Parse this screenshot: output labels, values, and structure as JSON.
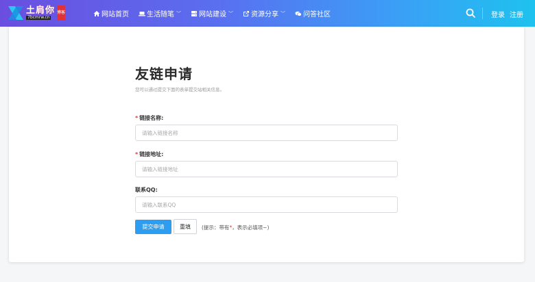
{
  "brand": {
    "logo_text": "土肩你",
    "logo_sub": "7bcmrw.cn",
    "logo_badge": "博客",
    "colors": {
      "header_start": "#6a4ee0",
      "header_end": "#1ec2ee",
      "accent": "#2e9df0",
      "required": "#e33333"
    }
  },
  "nav": {
    "items": [
      {
        "label": "网站首页",
        "icon": "home-icon",
        "has_dropdown": false
      },
      {
        "label": "生活随笔",
        "icon": "laptop-icon",
        "has_dropdown": true
      },
      {
        "label": "网站建设",
        "icon": "server-icon",
        "has_dropdown": true
      },
      {
        "label": "资源分享",
        "icon": "external-link-icon",
        "has_dropdown": true
      },
      {
        "label": "问答社区",
        "icon": "chat-icon",
        "has_dropdown": false
      }
    ]
  },
  "header_right": {
    "search_icon": "search-icon",
    "login": "登录",
    "register": "注册"
  },
  "form": {
    "title": "友链申请",
    "subtitle": "您可以通过提交下面的表单提交站相关信息。",
    "fields": [
      {
        "label": "链接名称:",
        "required": true,
        "placeholder": "请输入链接名称",
        "value": ""
      },
      {
        "label": "链接地址:",
        "required": true,
        "placeholder": "请输入链接地址",
        "value": ""
      },
      {
        "label": "联系QQ:",
        "required": false,
        "placeholder": "请输入联系QQ",
        "value": ""
      }
    ],
    "required_mark": "*",
    "submit_label": "提交申请",
    "reset_label": "重填",
    "hint_prefix": "(提示：带有",
    "hint_star": "*",
    "hint_suffix": "，表示必填项~)"
  }
}
